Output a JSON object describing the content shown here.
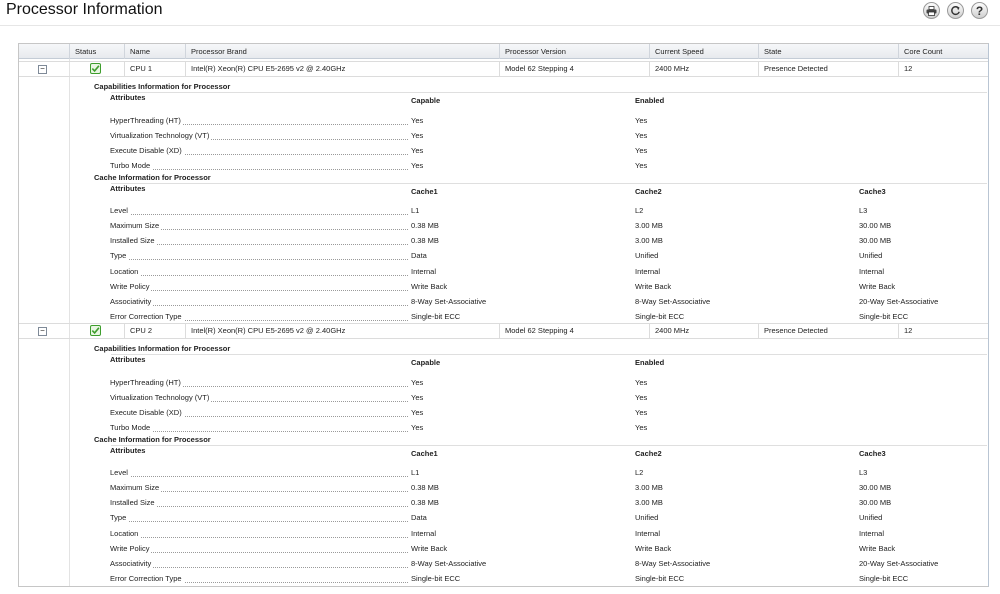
{
  "page": {
    "title": "Processor Information"
  },
  "toolbar": {
    "print_icon": "print-icon",
    "refresh_icon": "refresh-icon",
    "help_label": "?"
  },
  "table": {
    "columns": [
      "Status",
      "Name",
      "Processor Brand",
      "Processor Version",
      "Current Speed",
      "State",
      "Core Count"
    ],
    "processors": [
      {
        "expand_label": "−",
        "status_icon": "check-icon",
        "name": "CPU 1",
        "brand": "Intel(R) Xeon(R) CPU E5-2695 v2 @ 2.40GHz",
        "version": "Model 62 Stepping 4",
        "speed": "2400 MHz",
        "state": "Presence Detected",
        "cores": "12",
        "capabilities": {
          "title": "Capabilities Information for Processor",
          "headers": [
            "Attributes",
            "Capable",
            "Enabled"
          ],
          "rows": [
            {
              "label": "HyperThreading (HT)",
              "capable": "Yes",
              "enabled": "Yes"
            },
            {
              "label": "Virtualization Technology (VT)",
              "capable": "Yes",
              "enabled": "Yes"
            },
            {
              "label": "Execute Disable (XD)",
              "capable": "Yes",
              "enabled": "Yes"
            },
            {
              "label": "Turbo Mode",
              "capable": "Yes",
              "enabled": "Yes"
            }
          ]
        },
        "cache": {
          "title": "Cache Information for Processor",
          "headers": [
            "Attributes",
            "Cache1",
            "Cache2",
            "Cache3"
          ],
          "rows": [
            {
              "label": "Level",
              "c1": "L1",
              "c2": "L2",
              "c3": "L3"
            },
            {
              "label": "Maximum Size",
              "c1": "0.38 MB",
              "c2": "3.00 MB",
              "c3": "30.00 MB"
            },
            {
              "label": "Installed Size",
              "c1": "0.38 MB",
              "c2": "3.00 MB",
              "c3": "30.00 MB"
            },
            {
              "label": "Type",
              "c1": "Data",
              "c2": "Unified",
              "c3": "Unified"
            },
            {
              "label": "Location",
              "c1": "Internal",
              "c2": "Internal",
              "c3": "Internal"
            },
            {
              "label": "Write Policy",
              "c1": "Write Back",
              "c2": "Write Back",
              "c3": "Write Back"
            },
            {
              "label": "Associativity",
              "c1": "8-Way Set-Associative",
              "c2": "8-Way Set-Associative",
              "c3": "20-Way Set-Associative"
            },
            {
              "label": "Error Correction Type",
              "c1": "Single-bit ECC",
              "c2": "Single-bit ECC",
              "c3": "Single-bit ECC"
            }
          ]
        }
      },
      {
        "expand_label": "−",
        "status_icon": "check-icon",
        "name": "CPU 2",
        "brand": "Intel(R) Xeon(R) CPU E5-2695 v2 @ 2.40GHz",
        "version": "Model 62 Stepping 4",
        "speed": "2400 MHz",
        "state": "Presence Detected",
        "cores": "12",
        "capabilities": {
          "title": "Capabilities Information for Processor",
          "headers": [
            "Attributes",
            "Capable",
            "Enabled"
          ],
          "rows": [
            {
              "label": "HyperThreading (HT)",
              "capable": "Yes",
              "enabled": "Yes"
            },
            {
              "label": "Virtualization Technology (VT)",
              "capable": "Yes",
              "enabled": "Yes"
            },
            {
              "label": "Execute Disable (XD)",
              "capable": "Yes",
              "enabled": "Yes"
            },
            {
              "label": "Turbo Mode",
              "capable": "Yes",
              "enabled": "Yes"
            }
          ]
        },
        "cache": {
          "title": "Cache Information for Processor",
          "headers": [
            "Attributes",
            "Cache1",
            "Cache2",
            "Cache3"
          ],
          "rows": [
            {
              "label": "Level",
              "c1": "L1",
              "c2": "L2",
              "c3": "L3"
            },
            {
              "label": "Maximum Size",
              "c1": "0.38 MB",
              "c2": "3.00 MB",
              "c3": "30.00 MB"
            },
            {
              "label": "Installed Size",
              "c1": "0.38 MB",
              "c2": "3.00 MB",
              "c3": "30.00 MB"
            },
            {
              "label": "Type",
              "c1": "Data",
              "c2": "Unified",
              "c3": "Unified"
            },
            {
              "label": "Location",
              "c1": "Internal",
              "c2": "Internal",
              "c3": "Internal"
            },
            {
              "label": "Write Policy",
              "c1": "Write Back",
              "c2": "Write Back",
              "c3": "Write Back"
            },
            {
              "label": "Associativity",
              "c1": "8-Way Set-Associative",
              "c2": "8-Way Set-Associative",
              "c3": "20-Way Set-Associative"
            },
            {
              "label": "Error Correction Type",
              "c1": "Single-bit ECC",
              "c2": "Single-bit ECC",
              "c3": "Single-bit ECC"
            }
          ]
        }
      }
    ]
  },
  "colors": {
    "check_green": "#3e9d2d",
    "header_bg": "#e9ecf0",
    "border": "#c6c6c6"
  }
}
